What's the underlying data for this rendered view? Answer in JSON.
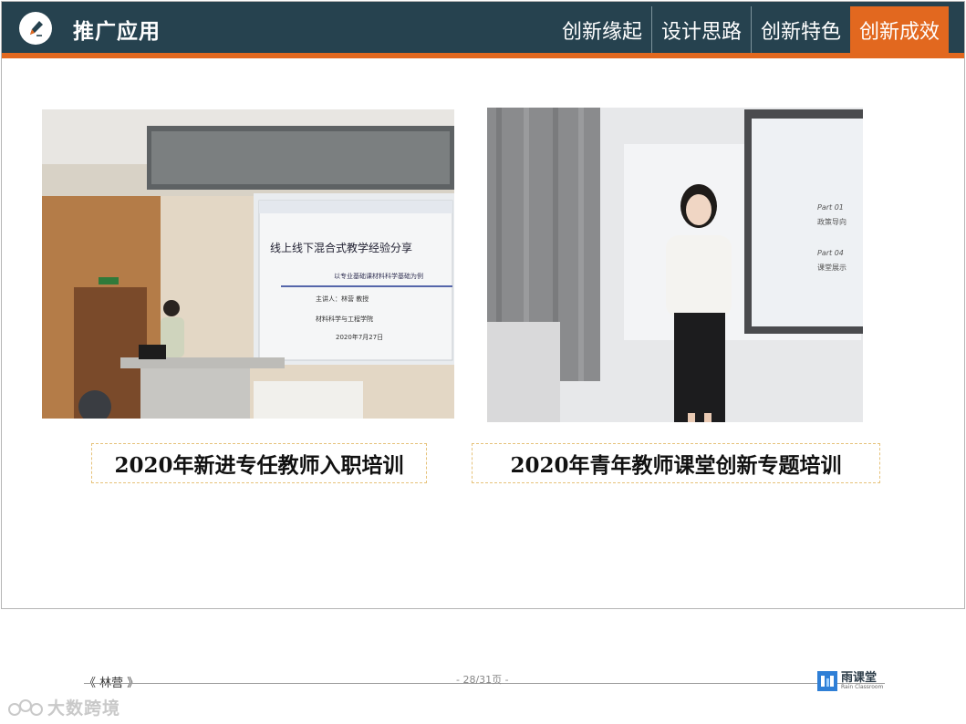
{
  "header": {
    "title": "推广应用",
    "tabs": [
      {
        "label": "创新缘起",
        "active": false
      },
      {
        "label": "设计思路",
        "active": false
      },
      {
        "label": "创新特色",
        "active": false
      },
      {
        "label": "创新成效",
        "active": true
      }
    ],
    "colors": {
      "bar": "#26424f",
      "accent": "#e2681f"
    }
  },
  "photos": {
    "left": {
      "screen_title": "线上线下混合式教学经验分享",
      "screen_subtitle": "以专业基础课材料科学基础为例",
      "screen_speaker": "主讲人：林营  教授",
      "screen_dept": "材料科学与工程学院",
      "screen_date": "2020年7月27日"
    },
    "right": {
      "screen_part1": "Part 01",
      "screen_part1_label": "政策导向",
      "screen_part2": "Part 04",
      "screen_part2_label": "课堂展示"
    }
  },
  "captions": {
    "left": "2020年新进专任教师入职培训",
    "right": "2020年青年教师课堂创新专题培训"
  },
  "footer": {
    "author": "《 林营 》",
    "page": "- 28/31页 -",
    "logo_name": "雨课堂",
    "logo_sub": "Rain Classroom",
    "watermark": "大数跨境"
  }
}
